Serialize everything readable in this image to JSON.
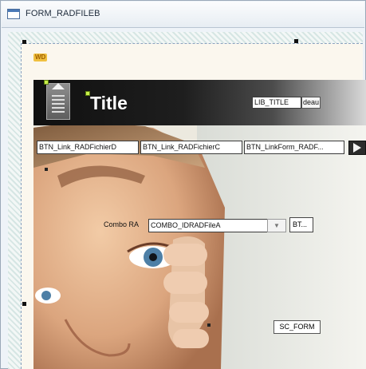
{
  "window": {
    "title": "FORM_RADFILEB",
    "icon": "window-form-icon"
  },
  "form": {
    "logo_text": "WD",
    "banner_title": "Title",
    "lib_title": "LIB_TITLE",
    "lib_title_suffix": "deau",
    "links": [
      {
        "label": "BTN_Link_RADFichierD"
      },
      {
        "label": "BTN_Link_RADFichierC"
      },
      {
        "label": "BTN_LinkForm_RADF..."
      }
    ],
    "next_icon": "arrow-right-icon",
    "combo_label": "Combo RA",
    "combo_value": "COMBO_IDRADFileA",
    "bt_label": "BT...",
    "sc_form": "SC_FORM"
  },
  "colors": {
    "banner_dark": "#101010",
    "selection_dot": "#c8f04a",
    "design_border": "#8aa2c0"
  }
}
